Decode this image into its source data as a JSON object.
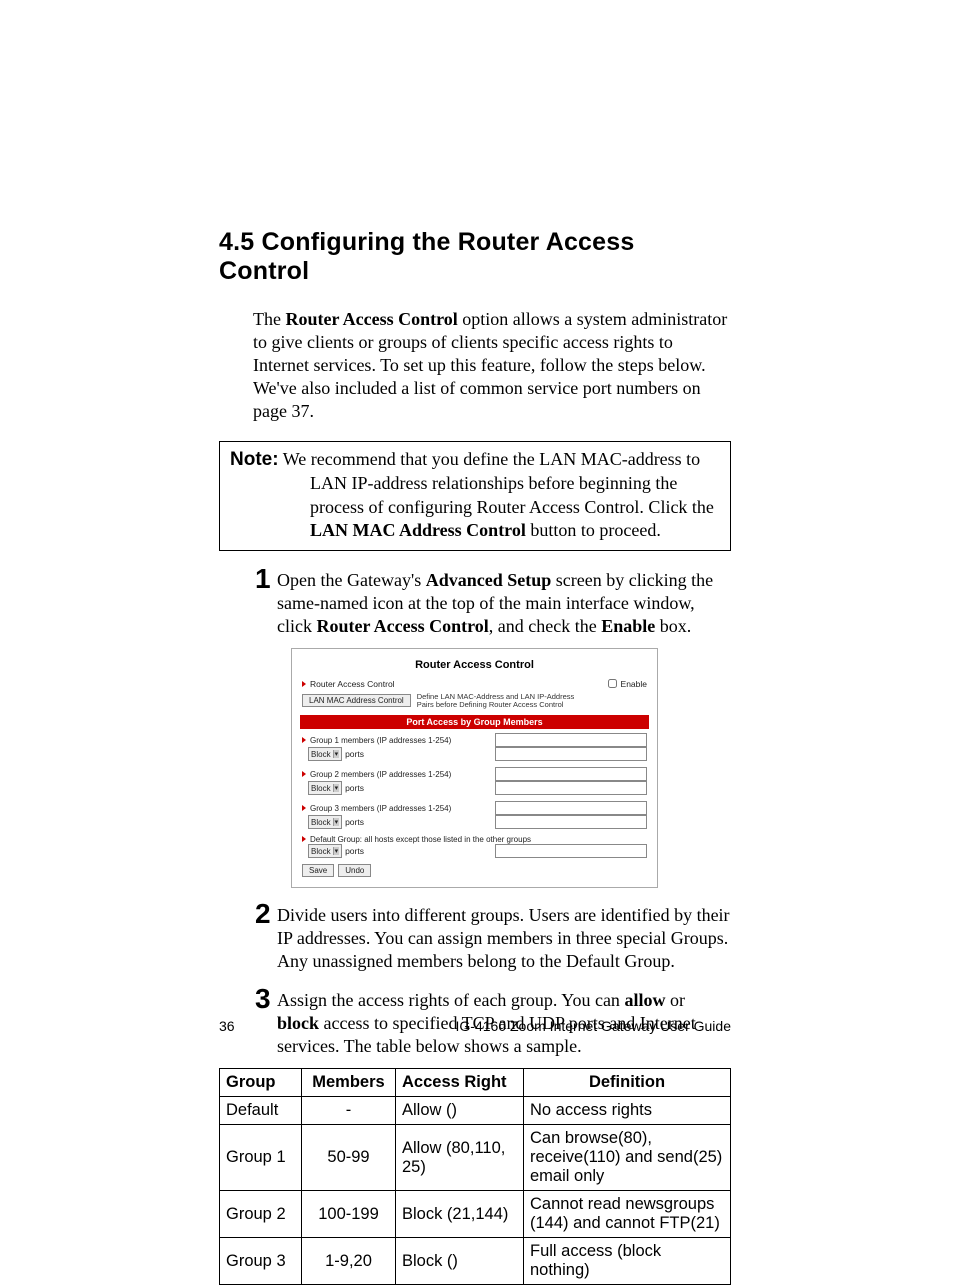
{
  "heading": "4.5 Configuring the Router Access Control",
  "intro": {
    "pre": "The ",
    "bold1": "Router Access Control",
    "post": " option allows a system administrator to give clients or groups of clients specific access rights to Internet services. To set up this feature, follow the steps below. We've also included a list of common service port numbers on page 37."
  },
  "note": {
    "label": "Note:",
    "line1": "We recommend that you define the LAN MAC-address to",
    "line2": "LAN IP-address relationships before beginning the",
    "line3": "process of configuring Router Access Control. Click the",
    "bold": "LAN MAC Address Control",
    "line4_post": " button to proceed."
  },
  "steps": {
    "s1": {
      "num": "1",
      "t1": "Open the Gateway's ",
      "b1": "Advanced Setup",
      "t2": " screen by clicking the same-named icon at the top of the main interface window, click ",
      "b2": "Router Access Control",
      "t3": ", and check the ",
      "b3": "Enable",
      "t4": " box."
    },
    "s2": {
      "num": "2",
      "text": "Divide users into different groups. Users are identified by their IP addresses. You can assign members in three special Groups. Any unassigned members belong to the Default Group."
    },
    "s3": {
      "num": "3",
      "t1": "Assign the access rights of each group. You can ",
      "b1": "allow",
      "t2": " or ",
      "b2": "block",
      "t3": " access to specified TCP and UDP ports and Internet services. The table below shows a sample."
    }
  },
  "rac": {
    "title": "Router Access Control",
    "top_label": "Router Access Control",
    "enable": "Enable",
    "lanmac_btn": "LAN MAC Address Control",
    "lanmac_note": "Define LAN MAC-Address and LAN IP-Address Pairs before Defining Router Access Control",
    "band": "Port Access by Group Members",
    "g1": "Group 1 members (IP addresses 1-254)",
    "g2": "Group 2 members (IP addresses 1-254)",
    "g3": "Group 3 members (IP addresses 1-254)",
    "gd": "Default Group: all hosts except those listed in the other groups",
    "block": "Block",
    "ports": "ports",
    "save": "Save",
    "undo": "Undo"
  },
  "table": {
    "headers": {
      "group": "Group",
      "members": "Members",
      "access": "Access Right",
      "def": "Definition"
    },
    "rows": [
      {
        "group": "Default",
        "members": "-",
        "access": "Allow ()",
        "def": "No access rights"
      },
      {
        "group": "Group 1",
        "members": "50-99",
        "access": "Allow (80,110, 25)",
        "def": "Can browse(80), receive(110) and send(25) email only"
      },
      {
        "group": "Group 2",
        "members": "100-199",
        "access": "Block (21,144)",
        "def": "Cannot read newsgroups (144) and cannot FTP(21)"
      },
      {
        "group": "Group 3",
        "members": "1-9,20",
        "access": "Block ()",
        "def": "Full access (block nothing)"
      }
    ]
  },
  "footer": {
    "page": "36",
    "title": "IG-4160 Zoom Internet Gateway User Guide"
  }
}
